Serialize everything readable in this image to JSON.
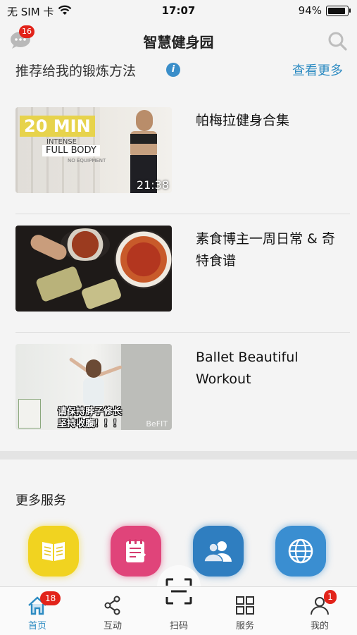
{
  "status_bar": {
    "carrier": "无 SIM 卡",
    "time": "17:07",
    "battery_text": "94%",
    "battery_level": 0.94
  },
  "nav": {
    "title": "智慧健身园",
    "message_badge": "16",
    "message_icon": "chat-bubble-icon",
    "search_icon": "search-icon"
  },
  "recommend": {
    "title": "推荐给我的锻炼方法",
    "info_icon": "info-icon",
    "more_label": "查看更多"
  },
  "videos": [
    {
      "title": "帕梅拉健身合集",
      "thumb": {
        "min_label": "20 MIN",
        "intense": "INTENSE",
        "full_body": "FULL BODY",
        "no_equipment": "NO EQUIPMENT",
        "duration": "21:38"
      }
    },
    {
      "title": "素食博主一周日常 & 奇特食谱"
    },
    {
      "title": "Ballet Beautiful Workout",
      "thumb": {
        "subtitle_line1": "请保持脖子修长",
        "subtitle_line2": "坚持收腹！！！",
        "brand": "BeFIT"
      }
    }
  ],
  "services": {
    "title": "更多服务",
    "items": [
      {
        "icon": "book-icon",
        "color": "#f1d320"
      },
      {
        "icon": "notepad-icon",
        "color": "#e0447a"
      },
      {
        "icon": "users-icon",
        "color": "#2f7ec0"
      },
      {
        "icon": "globe-icon",
        "color": "#3a8ed1"
      }
    ]
  },
  "tab_bar": {
    "items": [
      {
        "label": "首页",
        "icon": "home-icon",
        "badge": "18",
        "active": true
      },
      {
        "label": "互动",
        "icon": "share-icon"
      },
      {
        "label": "扫码",
        "icon": "scan-icon"
      },
      {
        "label": "服务",
        "icon": "grid-icon"
      },
      {
        "label": "我的",
        "icon": "user-icon",
        "badge": "1"
      }
    ]
  },
  "colors": {
    "accent": "#2d8bc2",
    "badge": "#e2231a",
    "background": "#f4f4f4"
  }
}
